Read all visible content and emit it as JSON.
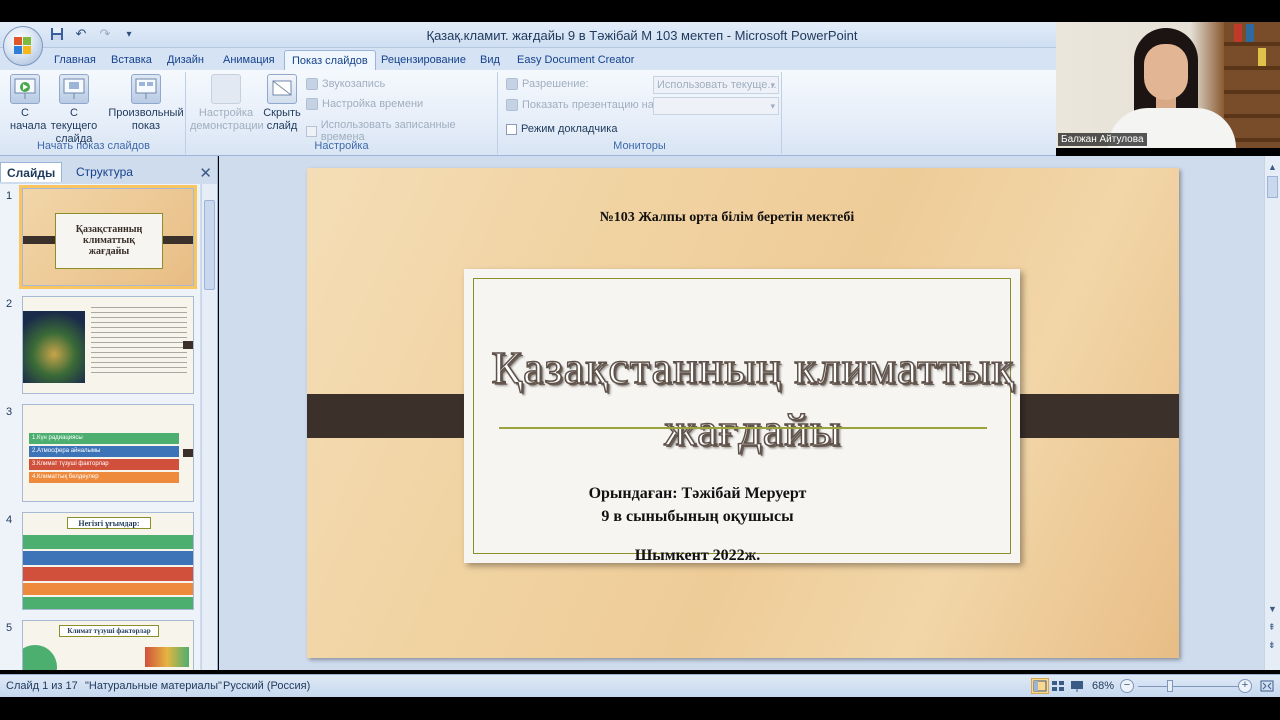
{
  "window": {
    "title": "Қазақ.кламит. жағдайы 9 в Тәжібай М 103  мектеп - Microsoft PowerPoint"
  },
  "qat": {
    "save_icon": "save-icon",
    "undo_icon": "undo-icon",
    "redo_icon": "redo-icon",
    "customize_icon": "customize-icon"
  },
  "ribbon_tabs": [
    "Главная",
    "Вставка",
    "Дизайн",
    "Анимация",
    "Показ слайдов",
    "Рецензирование",
    "Вид",
    "Easy Document Creator"
  ],
  "active_tab": "Показ слайдов",
  "ribbon": {
    "start_group": {
      "label": "Начать показ слайдов",
      "from_beginning": "С начала",
      "from_current": "С текущего слайда",
      "custom_show": "Произвольный показ"
    },
    "setup_group": {
      "label": "Настройка",
      "setup_show": "Настройка демонстрации",
      "hide_slide": "Скрыть слайд",
      "record_narration": "Звукозапись",
      "rehearse_timings": "Настройка времени",
      "use_timings": "Использовать записанные времена"
    },
    "monitors_group": {
      "label": "Мониторы",
      "resolution_label": "Разрешение:",
      "resolution_value": "Использовать текуще...",
      "show_on_label": "Показать презентацию на:",
      "show_on_value": "",
      "presenter_view": "Режим докладчика"
    }
  },
  "webcam": {
    "name": "Балжан Айтулова"
  },
  "left_pane": {
    "tab_slides": "Слайды",
    "tab_outline": "Структура",
    "slide_numbers": [
      "1",
      "2",
      "3",
      "4",
      "5"
    ],
    "thumb3_items": [
      "1.Күн радиациясы",
      "2.Атмосфера айналымы",
      "3.Климат түзуші факторлар",
      "4.Климаттық белдеулер"
    ],
    "thumb4_title": "Негізгі ұғымдар:",
    "thumb5_title": "Климат түзуші факторлар"
  },
  "slide": {
    "school": "№103 Жалпы орта білім беретін мектебі",
    "title_line1": "Қазақстанның климаттық",
    "title_line2": "жағдайы",
    "author_line1": "Орындаған:  Тәжібай Меруерт",
    "author_line2": "9 в сыныбының оқушысы",
    "city": "Шымкент 2022ж."
  },
  "status": {
    "slide_counter": "Слайд 1 из 17",
    "theme": "\"Натуральные материалы\"",
    "language": "Русский (Россия)",
    "zoom": "68%"
  },
  "colors": {
    "ribbon_bg": "#e6eef9",
    "accent_orange": "#f9c462",
    "band_dark": "#3b302a",
    "frame_olive": "#8a8f2c"
  }
}
